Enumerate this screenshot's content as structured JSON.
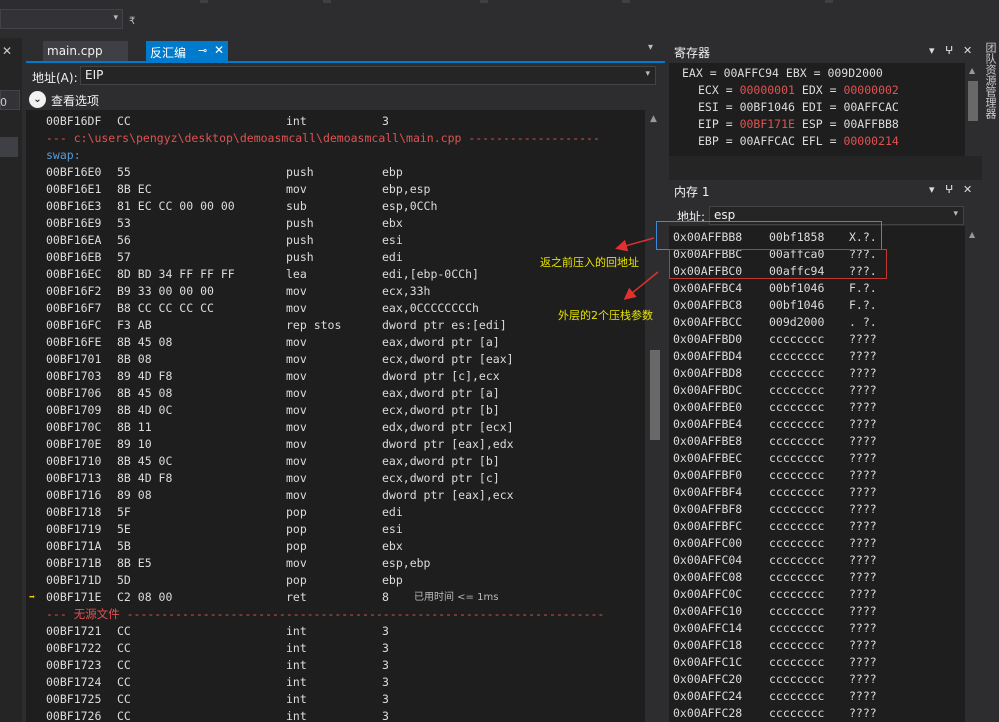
{
  "toolbar": {
    "dropdown_arrow": "▾",
    "glyph": "₹"
  },
  "tabs": [
    {
      "label": "main.cpp",
      "active": false
    },
    {
      "label": "反汇编",
      "active": true,
      "pin": "⊸",
      "close": "✕"
    }
  ],
  "disasm": {
    "address_label": "地址(A):",
    "address_value": "EIP",
    "options_label": "查看选项",
    "lines": [
      {
        "kind": "code",
        "addr": "00BF16DF",
        "bytes": "CC",
        "mn": "int",
        "op": "3"
      },
      {
        "kind": "src",
        "text": "--- c:\\users\\pengyz\\desktop\\demoasmcall\\demoasmcall\\main.cpp -------------------"
      },
      {
        "kind": "label",
        "text": "swap:"
      },
      {
        "kind": "code",
        "addr": "00BF16E0",
        "bytes": "55",
        "mn": "push",
        "op": "ebp"
      },
      {
        "kind": "code",
        "addr": "00BF16E1",
        "bytes": "8B EC",
        "mn": "mov",
        "op": "ebp,esp"
      },
      {
        "kind": "code",
        "addr": "00BF16E3",
        "bytes": "81 EC CC 00 00 00",
        "mn": "sub",
        "op": "esp,0CCh"
      },
      {
        "kind": "code",
        "addr": "00BF16E9",
        "bytes": "53",
        "mn": "push",
        "op": "ebx"
      },
      {
        "kind": "code",
        "addr": "00BF16EA",
        "bytes": "56",
        "mn": "push",
        "op": "esi"
      },
      {
        "kind": "code",
        "addr": "00BF16EB",
        "bytes": "57",
        "mn": "push",
        "op": "edi"
      },
      {
        "kind": "code",
        "addr": "00BF16EC",
        "bytes": "8D BD 34 FF FF FF",
        "mn": "lea",
        "op": "edi,[ebp-0CCh]"
      },
      {
        "kind": "code",
        "addr": "00BF16F2",
        "bytes": "B9 33 00 00 00",
        "mn": "mov",
        "op": "ecx,33h"
      },
      {
        "kind": "code",
        "addr": "00BF16F7",
        "bytes": "B8 CC CC CC CC",
        "mn": "mov",
        "op": "eax,0CCCCCCCCh"
      },
      {
        "kind": "code",
        "addr": "00BF16FC",
        "bytes": "F3 AB",
        "mn": "rep stos",
        "op": "dword ptr es:[edi]"
      },
      {
        "kind": "code",
        "addr": "00BF16FE",
        "bytes": "8B 45 08",
        "mn": "mov",
        "op": "eax,dword ptr [a]"
      },
      {
        "kind": "code",
        "addr": "00BF1701",
        "bytes": "8B 08",
        "mn": "mov",
        "op": "ecx,dword ptr [eax]"
      },
      {
        "kind": "code",
        "addr": "00BF1703",
        "bytes": "89 4D F8",
        "mn": "mov",
        "op": "dword ptr [c],ecx"
      },
      {
        "kind": "code",
        "addr": "00BF1706",
        "bytes": "8B 45 08",
        "mn": "mov",
        "op": "eax,dword ptr [a]"
      },
      {
        "kind": "code",
        "addr": "00BF1709",
        "bytes": "8B 4D 0C",
        "mn": "mov",
        "op": "ecx,dword ptr [b]"
      },
      {
        "kind": "code",
        "addr": "00BF170C",
        "bytes": "8B 11",
        "mn": "mov",
        "op": "edx,dword ptr [ecx]"
      },
      {
        "kind": "code",
        "addr": "00BF170E",
        "bytes": "89 10",
        "mn": "mov",
        "op": "dword ptr [eax],edx"
      },
      {
        "kind": "code",
        "addr": "00BF1710",
        "bytes": "8B 45 0C",
        "mn": "mov",
        "op": "eax,dword ptr [b]"
      },
      {
        "kind": "code",
        "addr": "00BF1713",
        "bytes": "8B 4D F8",
        "mn": "mov",
        "op": "ecx,dword ptr [c]"
      },
      {
        "kind": "code",
        "addr": "00BF1716",
        "bytes": "89 08",
        "mn": "mov",
        "op": "dword ptr [eax],ecx"
      },
      {
        "kind": "code",
        "addr": "00BF1718",
        "bytes": "5F",
        "mn": "pop",
        "op": "edi"
      },
      {
        "kind": "code",
        "addr": "00BF1719",
        "bytes": "5E",
        "mn": "pop",
        "op": "esi"
      },
      {
        "kind": "code",
        "addr": "00BF171A",
        "bytes": "5B",
        "mn": "pop",
        "op": "ebx"
      },
      {
        "kind": "code",
        "addr": "00BF171B",
        "bytes": "8B E5",
        "mn": "mov",
        "op": "esp,ebp"
      },
      {
        "kind": "code",
        "addr": "00BF171D",
        "bytes": "5D",
        "mn": "pop",
        "op": "ebp"
      },
      {
        "kind": "code",
        "addr": "00BF171E",
        "bytes": "C2 08 00",
        "mn": "ret",
        "op": "8",
        "current": true,
        "timing": "已用时间 <= 1ms"
      },
      {
        "kind": "src",
        "text": "--- 无源文件 ---------------------------------------------------------------------"
      },
      {
        "kind": "code",
        "addr": "00BF1721",
        "bytes": "CC",
        "mn": "int",
        "op": "3"
      },
      {
        "kind": "code",
        "addr": "00BF1722",
        "bytes": "CC",
        "mn": "int",
        "op": "3"
      },
      {
        "kind": "code",
        "addr": "00BF1723",
        "bytes": "CC",
        "mn": "int",
        "op": "3"
      },
      {
        "kind": "code",
        "addr": "00BF1724",
        "bytes": "CC",
        "mn": "int",
        "op": "3"
      },
      {
        "kind": "code",
        "addr": "00BF1725",
        "bytes": "CC",
        "mn": "int",
        "op": "3"
      },
      {
        "kind": "code",
        "addr": "00BF1726",
        "bytes": "CC",
        "mn": "int",
        "op": "3"
      }
    ]
  },
  "registers": {
    "title": "寄存器",
    "rows": [
      [
        {
          "n": "EAX",
          "v": "00AFFC94",
          "changed": false
        },
        {
          "n": "EBX",
          "v": "009D2000",
          "changed": false
        }
      ],
      [
        {
          "n": "ECX",
          "v": "00000001",
          "changed": true
        },
        {
          "n": "EDX",
          "v": "00000002",
          "changed": true
        }
      ],
      [
        {
          "n": "ESI",
          "v": "00BF1046",
          "changed": false
        },
        {
          "n": "EDI",
          "v": "00AFFCAC",
          "changed": false
        }
      ],
      [
        {
          "n": "EIP",
          "v": "00BF171E",
          "changed": true
        },
        {
          "n": "ESP",
          "v": "00AFFBB8",
          "changed": false
        }
      ],
      [
        {
          "n": "EBP",
          "v": "00AFFCAC",
          "changed": false
        },
        {
          "n": "EFL",
          "v": "00000214",
          "changed": true
        }
      ]
    ]
  },
  "memory": {
    "title": "内存 1",
    "address_label": "地址:",
    "address_value": "esp",
    "rows": [
      {
        "a": "0x00AFFBB8",
        "v": "00bf1858",
        "c": "X.?."
      },
      {
        "a": "0x00AFFBBC",
        "v": "00affca0",
        "c": "???."
      },
      {
        "a": "0x00AFFBC0",
        "v": "00affc94",
        "c": "???."
      },
      {
        "a": "0x00AFFBC4",
        "v": "00bf1046",
        "c": "F.?."
      },
      {
        "a": "0x00AFFBC8",
        "v": "00bf1046",
        "c": "F.?."
      },
      {
        "a": "0x00AFFBCC",
        "v": "009d2000",
        "c": ". ?."
      },
      {
        "a": "0x00AFFBD0",
        "v": "cccccccc",
        "c": "????"
      },
      {
        "a": "0x00AFFBD4",
        "v": "cccccccc",
        "c": "????"
      },
      {
        "a": "0x00AFFBD8",
        "v": "cccccccc",
        "c": "????"
      },
      {
        "a": "0x00AFFBDC",
        "v": "cccccccc",
        "c": "????"
      },
      {
        "a": "0x00AFFBE0",
        "v": "cccccccc",
        "c": "????"
      },
      {
        "a": "0x00AFFBE4",
        "v": "cccccccc",
        "c": "????"
      },
      {
        "a": "0x00AFFBE8",
        "v": "cccccccc",
        "c": "????"
      },
      {
        "a": "0x00AFFBEC",
        "v": "cccccccc",
        "c": "????"
      },
      {
        "a": "0x00AFFBF0",
        "v": "cccccccc",
        "c": "????"
      },
      {
        "a": "0x00AFFBF4",
        "v": "cccccccc",
        "c": "????"
      },
      {
        "a": "0x00AFFBF8",
        "v": "cccccccc",
        "c": "????"
      },
      {
        "a": "0x00AFFBFC",
        "v": "cccccccc",
        "c": "????"
      },
      {
        "a": "0x00AFFC00",
        "v": "cccccccc",
        "c": "????"
      },
      {
        "a": "0x00AFFC04",
        "v": "cccccccc",
        "c": "????"
      },
      {
        "a": "0x00AFFC08",
        "v": "cccccccc",
        "c": "????"
      },
      {
        "a": "0x00AFFC0C",
        "v": "cccccccc",
        "c": "????"
      },
      {
        "a": "0x00AFFC10",
        "v": "cccccccc",
        "c": "????"
      },
      {
        "a": "0x00AFFC14",
        "v": "cccccccc",
        "c": "????"
      },
      {
        "a": "0x00AFFC18",
        "v": "cccccccc",
        "c": "????"
      },
      {
        "a": "0x00AFFC1C",
        "v": "cccccccc",
        "c": "????"
      },
      {
        "a": "0x00AFFC20",
        "v": "cccccccc",
        "c": "????"
      },
      {
        "a": "0x00AFFC24",
        "v": "cccccccc",
        "c": "????"
      },
      {
        "a": "0x00AFFC28",
        "v": "cccccccc",
        "c": "????"
      }
    ]
  },
  "annotations": {
    "return_address": "返之前压入的回地址",
    "outer_params": "外层的2个压栈参数"
  },
  "right_strip_label": "团队资源管理器",
  "panel_icons": {
    "menu": "▾",
    "pin": "ⵖ",
    "close": "✕"
  },
  "left_strip": {
    "close": "✕",
    "item": "0"
  },
  "colors": {
    "accent": "#007acc",
    "changed": "#e05252",
    "note": "#e8e400"
  }
}
